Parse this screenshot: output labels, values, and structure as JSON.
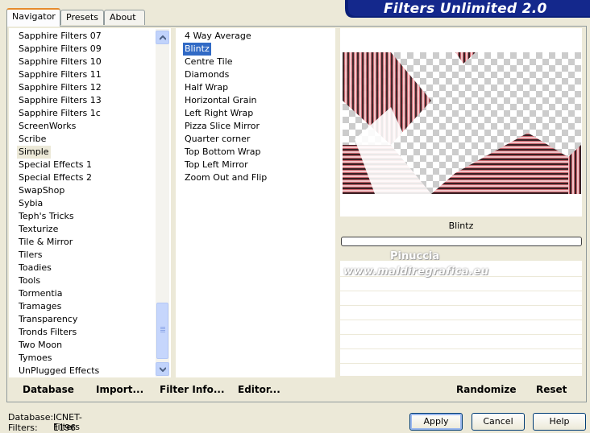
{
  "tabs": [
    "Navigator",
    "Presets",
    "About"
  ],
  "title": "Filters Unlimited 2.0",
  "categories": {
    "items": [
      "Sapphire Filters 07",
      "Sapphire Filters 09",
      "Sapphire Filters 10",
      "Sapphire Filters 11",
      "Sapphire Filters 12",
      "Sapphire Filters 13",
      "Sapphire Filters 1c",
      "ScreenWorks",
      "Scribe",
      "Simple",
      "Special Effects 1",
      "Special Effects 2",
      "SwapShop",
      "Sybia",
      "Teph's Tricks",
      "Texturize",
      "Tile & Mirror",
      "Tilers",
      "Toadies",
      "Tools",
      "Tormentia",
      "Tramages",
      "Transparency",
      "Tronds Filters",
      "Two Moon",
      "Tymoes",
      "UnPlugged Effects"
    ],
    "selected": "Simple"
  },
  "filters": {
    "items": [
      "4 Way Average",
      "Blintz",
      "Centre Tile",
      "Diamonds",
      "Half Wrap",
      "Horizontal Grain",
      "Left Right Wrap",
      "Pizza Slice Mirror",
      "Quarter corner",
      "Top Bottom Wrap",
      "Top Left Mirror",
      "Zoom Out and Flip"
    ],
    "selected": "Blintz"
  },
  "preview": {
    "filter_name": "Blintz",
    "watermark_name": "Pinuccia",
    "watermark_url": "www.maldiregrafica.eu"
  },
  "toolbar": {
    "database": "Database",
    "import": "Import...",
    "filter_info": "Filter Info...",
    "editor": "Editor...",
    "randomize": "Randomize",
    "reset": "Reset"
  },
  "status": {
    "database_label": "Database:",
    "database_value": "ICNET-Filters",
    "filters_label": "Filters:",
    "filters_value": "1196"
  },
  "buttons": {
    "apply": "Apply",
    "cancel": "Cancel",
    "help": "Help"
  },
  "colors": {
    "banner": "#0a1f78",
    "selection": "#316ac5",
    "face": "#ece9d8"
  }
}
